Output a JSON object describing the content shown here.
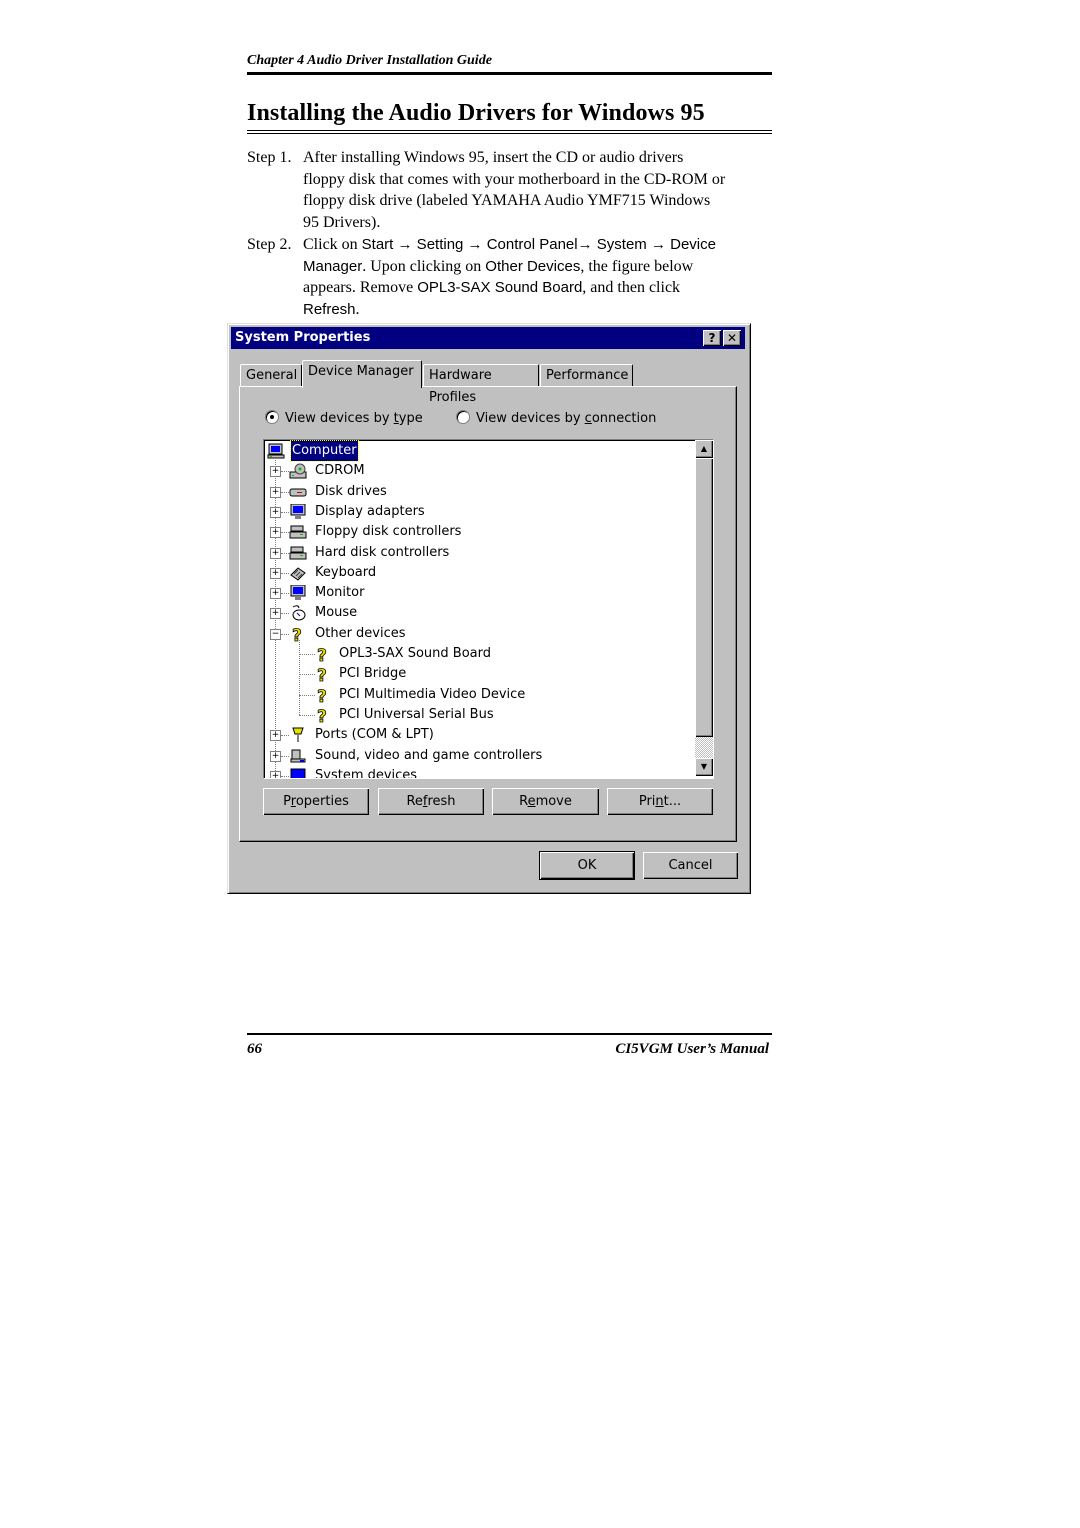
{
  "header": {
    "chapter": "Chapter 4  Audio Driver Installation Guide",
    "title": "Installing the Audio Drivers for Windows 95"
  },
  "steps": [
    {
      "number": "Step 1.",
      "lines": [
        "After installing Windows 95, insert the CD or audio drivers",
        "floppy disk that comes with your motherboard in the CD-ROM or",
        "floppy disk drive (labeled YAMAHA Audio YMF715 Windows",
        "95 Drivers)."
      ]
    },
    {
      "number": "Step 2.",
      "line1_prefix": "Click on ",
      "line1_path": "Start → Setting → Control Panel→ System → Device",
      "line2_path": "Manager",
      "line2_mid": ". Upon clicking on ",
      "line2_other": "Other Devices",
      "line2_suffix": ", the figure below",
      "line3_prefix": "appears. Remove ",
      "line3_device": "OPL3-SAX Sound Board",
      "line3_suffix": ", and then click",
      "line4": "Refresh",
      "line4_suffix": "."
    }
  ],
  "dialog": {
    "title": "System Properties",
    "help_button": "?",
    "close_button": "✕",
    "tabs": [
      "General",
      "Device Manager",
      "Hardware Profiles",
      "Performance"
    ],
    "active_tab": "Device Manager",
    "view_options": {
      "by_type": {
        "pre": "View devices by ",
        "accel": "t",
        "post": "ype",
        "selected": true
      },
      "by_connection": {
        "pre": "View devices by ",
        "accel": "c",
        "post": "onnection",
        "selected": false
      }
    },
    "tree": {
      "root": "Computer",
      "items": [
        {
          "label": "CDROM",
          "icon": "cdrom-icon",
          "expander": "+"
        },
        {
          "label": "Disk drives",
          "icon": "disk-drive-icon",
          "expander": "+"
        },
        {
          "label": "Display adapters",
          "icon": "display-adapter-icon",
          "expander": "+"
        },
        {
          "label": "Floppy disk controllers",
          "icon": "controller-icon",
          "expander": "+"
        },
        {
          "label": "Hard disk controllers",
          "icon": "controller-icon",
          "expander": "+"
        },
        {
          "label": "Keyboard",
          "icon": "keyboard-icon",
          "expander": "+"
        },
        {
          "label": "Monitor",
          "icon": "monitor-icon",
          "expander": "+"
        },
        {
          "label": "Mouse",
          "icon": "mouse-icon",
          "expander": "+"
        },
        {
          "label": "Other devices",
          "icon": "question-icon",
          "expander": "−"
        },
        {
          "label": "OPL3-SAX Sound Board",
          "icon": "question-icon",
          "child": true
        },
        {
          "label": "PCI Bridge",
          "icon": "question-icon",
          "child": true
        },
        {
          "label": "PCI Multimedia Video Device",
          "icon": "question-icon",
          "child": true
        },
        {
          "label": "PCI Universal Serial Bus",
          "icon": "question-icon",
          "child": true
        },
        {
          "label": "Ports (COM & LPT)",
          "icon": "port-icon",
          "expander": "+"
        },
        {
          "label": "Sound, video and game controllers",
          "icon": "sound-controller-icon",
          "expander": "+"
        },
        {
          "label": "System devices",
          "icon": "system-device-icon",
          "expander": "+"
        }
      ]
    },
    "buttons": {
      "properties": {
        "pre": "P",
        "accel": "r",
        "post": "operties"
      },
      "refresh": {
        "pre": "Re",
        "accel": "f",
        "post": "resh"
      },
      "remove": {
        "pre": "R",
        "accel": "e",
        "post": "move"
      },
      "print": {
        "pre": "Pri",
        "accel": "n",
        "post": "t..."
      },
      "ok": "OK",
      "cancel": "Cancel"
    }
  },
  "footer": {
    "page_number": "66",
    "manual": "CI5VGM User’s Manual"
  }
}
